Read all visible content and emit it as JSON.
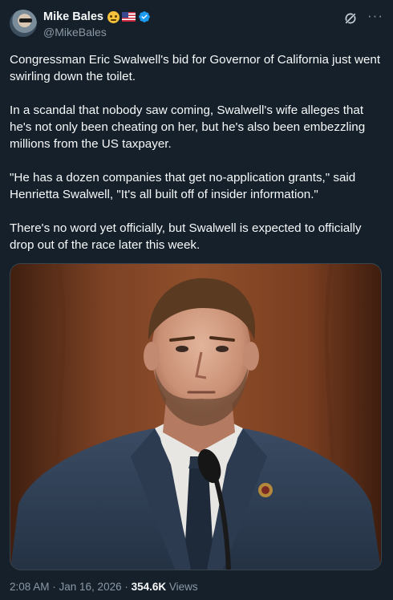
{
  "author": {
    "name": "Mike Bales",
    "handle": "@MikeBales",
    "avatar_icon": "profile-photo",
    "badges": [
      "smiling-face-emoji",
      "us-flag-emoji",
      "verified-badge-icon"
    ],
    "verified_color": "#1d9bf0"
  },
  "actions": {
    "grok_icon": "grok-icon",
    "more_label": "···"
  },
  "tweet": {
    "paragraphs": [
      "Congressman Eric Swalwell's bid for Governor of California just went swirling down the toilet.",
      "In a scandal that nobody saw coming, Swalwell's wife alleges that he's not only been cheating on her, but he's also been embezzling millions from the US taxpayer.",
      "\"He has a dozen companies that get no-application grants,\" said Henrietta Swalwell, \"It's all built off of insider information.\"",
      "There's no word yet officially, but Swalwell is expected to officially drop out of the race later this week."
    ],
    "media": {
      "description_icon": "photo-man-in-suit-at-microphone"
    }
  },
  "meta": {
    "timestamp": "2:08 AM · Jan 16, 2026 · ",
    "views_count": "354.6K",
    "views_label": " Views"
  },
  "colors": {
    "background": "#15202b",
    "text": "#f7f9f9",
    "secondary_text": "#8b98a5",
    "border": "#38444d"
  }
}
